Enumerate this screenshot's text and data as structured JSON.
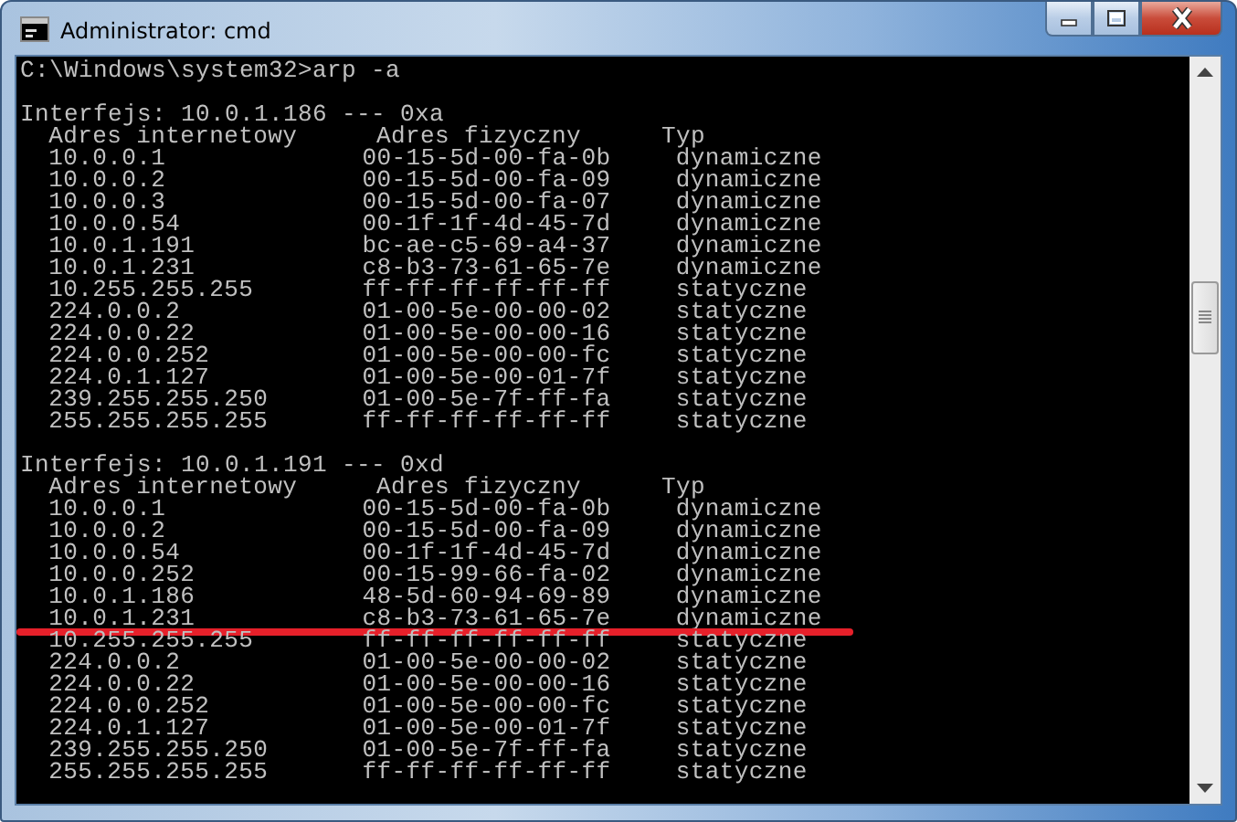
{
  "window": {
    "title": "Administrator: cmd"
  },
  "console": {
    "prompt": "C:\\Windows\\system32>arp -a",
    "blocks": [
      {
        "interface": "Interfejs: 10.0.1.186 --- 0xa",
        "columns": [
          "Adres internetowy",
          "Adres fizyczny",
          "Typ"
        ],
        "rows": [
          {
            "ip": "10.0.0.1",
            "mac": "00-15-5d-00-fa-0b",
            "type": "dynamiczne",
            "underlined": false
          },
          {
            "ip": "10.0.0.2",
            "mac": "00-15-5d-00-fa-09",
            "type": "dynamiczne",
            "underlined": false
          },
          {
            "ip": "10.0.0.3",
            "mac": "00-15-5d-00-fa-07",
            "type": "dynamiczne",
            "underlined": false
          },
          {
            "ip": "10.0.0.54",
            "mac": "00-1f-1f-4d-45-7d",
            "type": "dynamiczne",
            "underlined": false
          },
          {
            "ip": "10.0.1.191",
            "mac": "bc-ae-c5-69-a4-37",
            "type": "dynamiczne",
            "underlined": false
          },
          {
            "ip": "10.0.1.231",
            "mac": "c8-b3-73-61-65-7e",
            "type": "dynamiczne",
            "underlined": false
          },
          {
            "ip": "10.255.255.255",
            "mac": "ff-ff-ff-ff-ff-ff",
            "type": "statyczne",
            "underlined": false
          },
          {
            "ip": "224.0.0.2",
            "mac": "01-00-5e-00-00-02",
            "type": "statyczne",
            "underlined": false
          },
          {
            "ip": "224.0.0.22",
            "mac": "01-00-5e-00-00-16",
            "type": "statyczne",
            "underlined": false
          },
          {
            "ip": "224.0.0.252",
            "mac": "01-00-5e-00-00-fc",
            "type": "statyczne",
            "underlined": false
          },
          {
            "ip": "224.0.1.127",
            "mac": "01-00-5e-00-01-7f",
            "type": "statyczne",
            "underlined": false
          },
          {
            "ip": "239.255.255.250",
            "mac": "01-00-5e-7f-ff-fa",
            "type": "statyczne",
            "underlined": false
          },
          {
            "ip": "255.255.255.255",
            "mac": "ff-ff-ff-ff-ff-ff",
            "type": "statyczne",
            "underlined": false
          }
        ]
      },
      {
        "interface": "Interfejs: 10.0.1.191 --- 0xd",
        "columns": [
          "Adres internetowy",
          "Adres fizyczny",
          "Typ"
        ],
        "rows": [
          {
            "ip": "10.0.0.1",
            "mac": "00-15-5d-00-fa-0b",
            "type": "dynamiczne",
            "underlined": false
          },
          {
            "ip": "10.0.0.2",
            "mac": "00-15-5d-00-fa-09",
            "type": "dynamiczne",
            "underlined": false
          },
          {
            "ip": "10.0.0.54",
            "mac": "00-1f-1f-4d-45-7d",
            "type": "dynamiczne",
            "underlined": false
          },
          {
            "ip": "10.0.0.252",
            "mac": "00-15-99-66-fa-02",
            "type": "dynamiczne",
            "underlined": false
          },
          {
            "ip": "10.0.1.186",
            "mac": "48-5d-60-94-69-89",
            "type": "dynamiczne",
            "underlined": false
          },
          {
            "ip": "10.0.1.231",
            "mac": "c8-b3-73-61-65-7e",
            "type": "dynamiczne",
            "underlined": true
          },
          {
            "ip": "10.255.255.255",
            "mac": "ff-ff-ff-ff-ff-ff",
            "type": "statyczne",
            "underlined": false
          },
          {
            "ip": "224.0.0.2",
            "mac": "01-00-5e-00-00-02",
            "type": "statyczne",
            "underlined": false
          },
          {
            "ip": "224.0.0.22",
            "mac": "01-00-5e-00-00-16",
            "type": "statyczne",
            "underlined": false
          },
          {
            "ip": "224.0.0.252",
            "mac": "01-00-5e-00-00-fc",
            "type": "statyczne",
            "underlined": false
          },
          {
            "ip": "224.0.1.127",
            "mac": "01-00-5e-00-01-7f",
            "type": "statyczne",
            "underlined": false
          },
          {
            "ip": "239.255.255.250",
            "mac": "01-00-5e-7f-ff-fa",
            "type": "statyczne",
            "underlined": false
          },
          {
            "ip": "255.255.255.255",
            "mac": "ff-ff-ff-ff-ff-ff",
            "type": "statyczne",
            "underlined": false
          }
        ]
      }
    ]
  }
}
